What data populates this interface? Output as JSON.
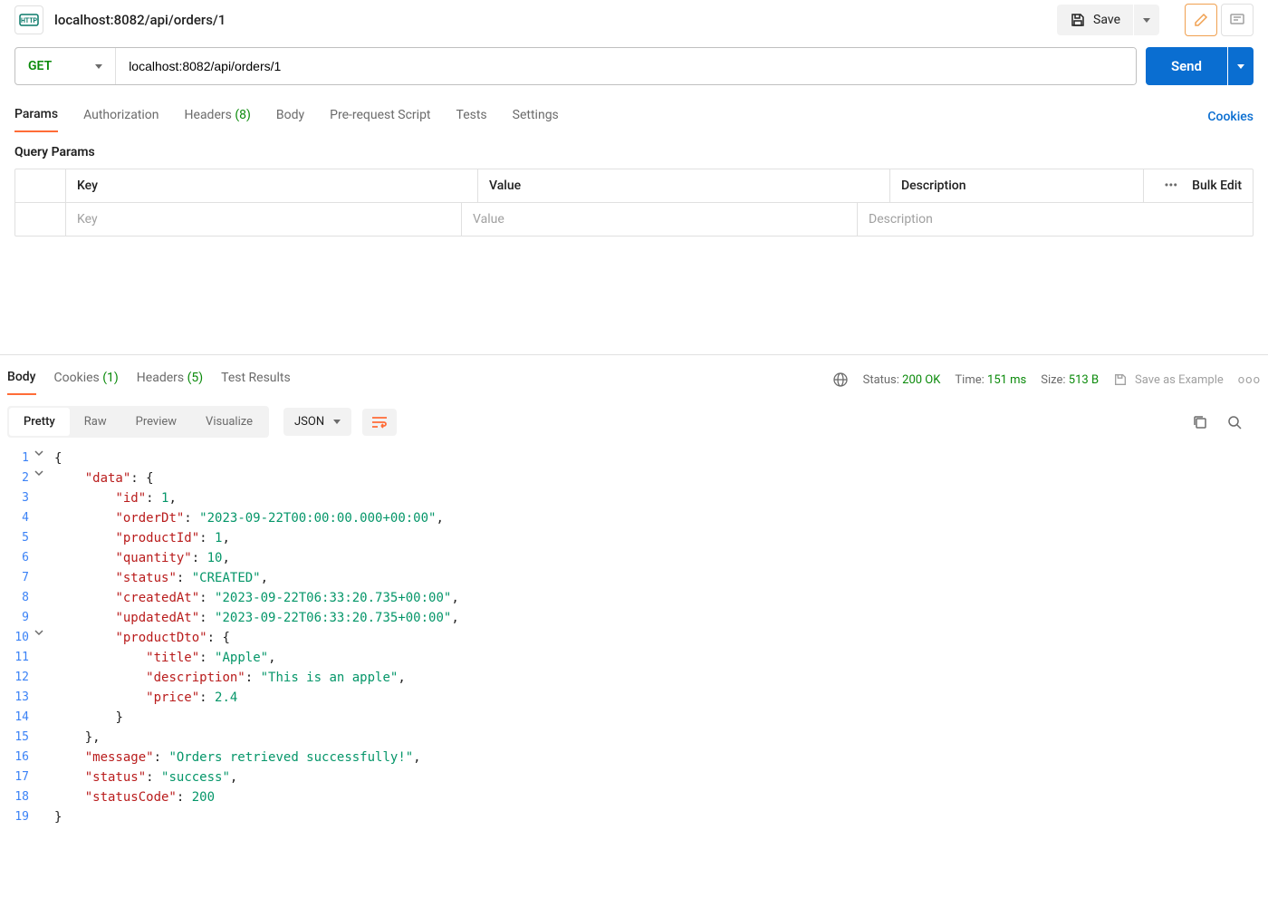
{
  "header": {
    "http_badge": "HTTP",
    "title": "localhost:8082/api/orders/1",
    "save_label": "Save"
  },
  "request": {
    "method": "GET",
    "url": "localhost:8082/api/orders/1",
    "send_label": "Send"
  },
  "req_tabs": {
    "params": "Params",
    "authorization": "Authorization",
    "headers_label": "Headers",
    "headers_count": "(8)",
    "body": "Body",
    "prerequest": "Pre-request Script",
    "tests": "Tests",
    "settings": "Settings",
    "cookies_link": "Cookies"
  },
  "params_section": {
    "title": "Query Params",
    "col_key": "Key",
    "col_value": "Value",
    "col_desc": "Description",
    "bulk_edit": "Bulk Edit",
    "placeholder_key": "Key",
    "placeholder_value": "Value",
    "placeholder_desc": "Description"
  },
  "resp_tabs": {
    "body": "Body",
    "cookies_label": "Cookies",
    "cookies_count": "(1)",
    "headers_label": "Headers",
    "headers_count": "(5)",
    "test_results": "Test Results"
  },
  "resp_meta": {
    "status_label": "Status:",
    "status_val": "200 OK",
    "time_label": "Time:",
    "time_val": "151 ms",
    "size_label": "Size:",
    "size_val": "513 B",
    "save_example": "Save as Example"
  },
  "body_toolbar": {
    "pretty": "Pretty",
    "raw": "Raw",
    "preview": "Preview",
    "visualize": "Visualize",
    "format": "JSON"
  },
  "json_body": {
    "data": {
      "id": 1,
      "orderDt": "2023-09-22T00:00:00.000+00:00",
      "productId": 1,
      "quantity": 10,
      "status": "CREATED",
      "createdAt": "2023-09-22T06:33:20.735+00:00",
      "updatedAt": "2023-09-22T06:33:20.735+00:00",
      "productDto": {
        "title": "Apple",
        "description": "This is an apple",
        "price": 2.4
      }
    },
    "message": "Orders retrieved successfully!",
    "status": "success",
    "statusCode": 200
  }
}
